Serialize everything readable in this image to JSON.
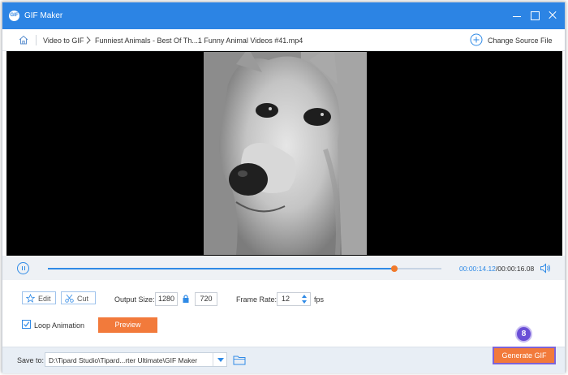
{
  "window": {
    "title": "GIF Maker",
    "app_icon_text": "GIF"
  },
  "breadcrumb": {
    "root": "Video to GIF",
    "file": "Funniest Animals - Best Of Th...1 Funny Animal Videos #41.mp4"
  },
  "change_source_label": "Change Source File",
  "playback": {
    "current": "00:00:14.12",
    "separator": "/",
    "total": "00:00:16.08",
    "progress": 0.88
  },
  "tools": {
    "edit_label": "Edit",
    "cut_label": "Cut"
  },
  "output": {
    "label": "Output Size:",
    "width": "1280",
    "height": "720"
  },
  "framerate": {
    "label": "Frame Rate:",
    "value": "12",
    "unit": "fps"
  },
  "loop": {
    "label": "Loop Animation",
    "checked": true
  },
  "preview_label": "Preview",
  "footer": {
    "save_label": "Save to:",
    "save_path": "D:\\Tipard Studio\\Tipard...rter Ultimate\\GIF Maker",
    "generate_label": "Generate GIF"
  },
  "step_badge": "8",
  "colors": {
    "accent": "#2c84e4",
    "orange": "#f27a3b",
    "badge": "#6a4fd6"
  }
}
